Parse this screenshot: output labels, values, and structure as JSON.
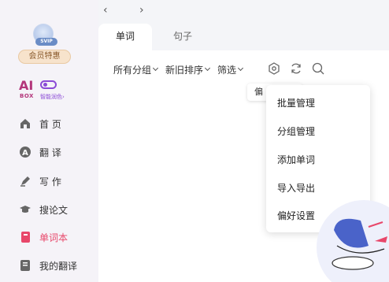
{
  "sidebar": {
    "vip_badge": "SVIP",
    "member_button": "会员特惠",
    "aibox": {
      "ai": "AI",
      "box": "BOX",
      "smart_color": "智能润色›"
    },
    "items": [
      {
        "label": "首 页",
        "icon": "home-icon"
      },
      {
        "label": "翻 译",
        "icon": "translate-icon"
      },
      {
        "label": "写 作",
        "icon": "pen-icon"
      },
      {
        "label": "搜论文",
        "icon": "graduation-cap-icon"
      },
      {
        "label": "单词本",
        "icon": "notebook-icon",
        "active": true
      },
      {
        "label": "我的翻译",
        "icon": "document-icon"
      }
    ]
  },
  "nav": {
    "back": "‹",
    "forward": "›"
  },
  "tabs": {
    "active": "单词",
    "inactive": "句子"
  },
  "filters": [
    {
      "label": "所有分组"
    },
    {
      "label": "新旧排序"
    },
    {
      "label": "筛选"
    }
  ],
  "tooltip": {
    "text": "偏"
  },
  "dropdown": {
    "items": [
      "批量管理",
      "分组管理",
      "添加单词",
      "导入导出",
      "偏好设置"
    ]
  },
  "colors": {
    "accent": "#e8476a",
    "aibox": "#b3357a",
    "toggle": "#8b4bd6"
  }
}
